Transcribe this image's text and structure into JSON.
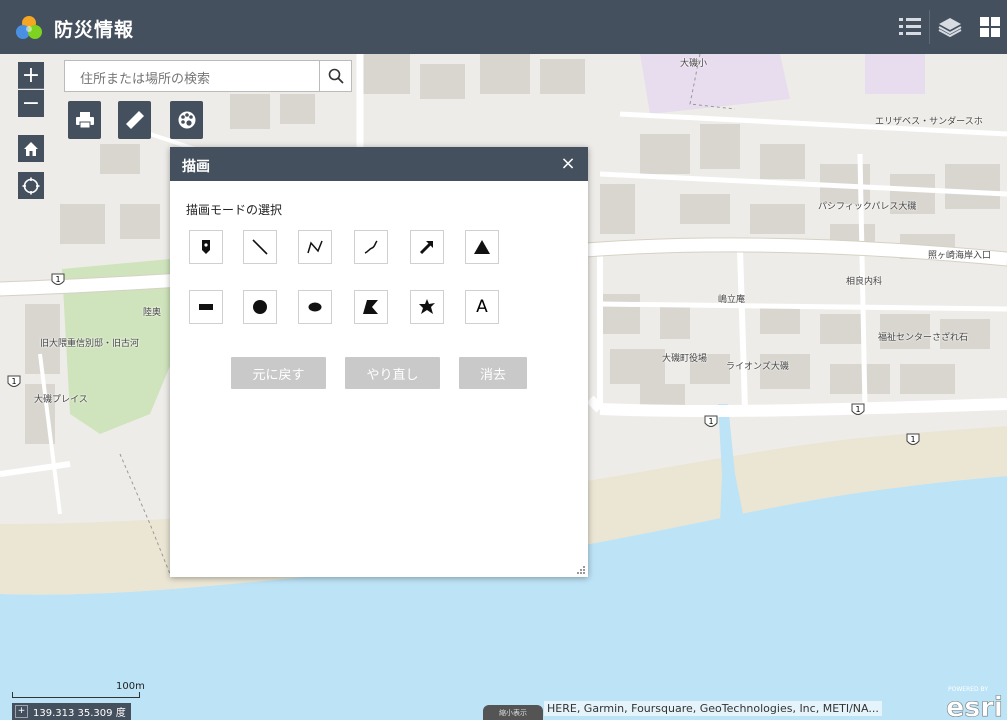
{
  "app": {
    "title": "防災情報",
    "icons": {
      "logo": "app-logo-icon",
      "legend": "legend-list-icon",
      "layers": "layers-stack-icon",
      "apps": "app-grid-icon"
    }
  },
  "map_controls": {
    "zoom_in_label": "+",
    "zoom_out_label": "−",
    "icons": {
      "home": "home-icon",
      "locate": "locate-icon"
    }
  },
  "search": {
    "placeholder": "住所または場所の検索",
    "icon": "search-icon"
  },
  "toolbar": {
    "icons": {
      "print": "printer-icon",
      "measure": "ruler-icon",
      "draw": "draw-palette-icon"
    }
  },
  "draw_panel": {
    "title": "描画",
    "close_label": "×",
    "mode_label": "描画モードの選択",
    "modes_row1": [
      {
        "name": "point",
        "icon": "point-marker-icon"
      },
      {
        "name": "line",
        "icon": "line-icon"
      },
      {
        "name": "polyline",
        "icon": "polyline-icon"
      },
      {
        "name": "freehand-polyline",
        "icon": "freehand-line-icon"
      },
      {
        "name": "arrow",
        "icon": "arrow-icon"
      },
      {
        "name": "triangle",
        "icon": "triangle-icon"
      }
    ],
    "modes_row2": [
      {
        "name": "rectangle",
        "icon": "rectangle-icon"
      },
      {
        "name": "circle",
        "icon": "circle-icon"
      },
      {
        "name": "ellipse",
        "icon": "ellipse-icon"
      },
      {
        "name": "polygon",
        "icon": "polygon-icon"
      },
      {
        "name": "freehand-polygon",
        "icon": "freehand-polygon-icon"
      },
      {
        "name": "text",
        "icon": "text-icon",
        "glyph": "A"
      }
    ],
    "undo_label": "元に戻す",
    "redo_label": "やり直し",
    "clear_label": "消去"
  },
  "map": {
    "labels": [
      "大磯小",
      "エリザベス・サンダースホ",
      "パシフィックパレス大磯",
      "照ヶ崎海岸入口",
      "相良内科",
      "嶋立庵",
      "福祉センターさざれ石",
      "大磯町役場",
      "ライオンズ大磯",
      "陸奥",
      "旧大隈重信別邸・旧古河",
      "大磯プレイス"
    ],
    "route_shields": [
      "1",
      "1",
      "1",
      "1",
      "1"
    ],
    "colors": {
      "water": "#bde3f6",
      "beach": "#ebe5d4",
      "park": "#cfe4bc",
      "school": "#e8dcef",
      "header": "#45505f"
    }
  },
  "status": {
    "scale_label": "100m",
    "coordinates": "139.313 35.309 度",
    "attribution_zoom": "縮小表示",
    "attribution": "HERE, Garmin, Foursquare, GeoTechnologies, Inc, METI/NA...",
    "esri_powered": "POWERED BY",
    "esri_logo": "esri"
  }
}
